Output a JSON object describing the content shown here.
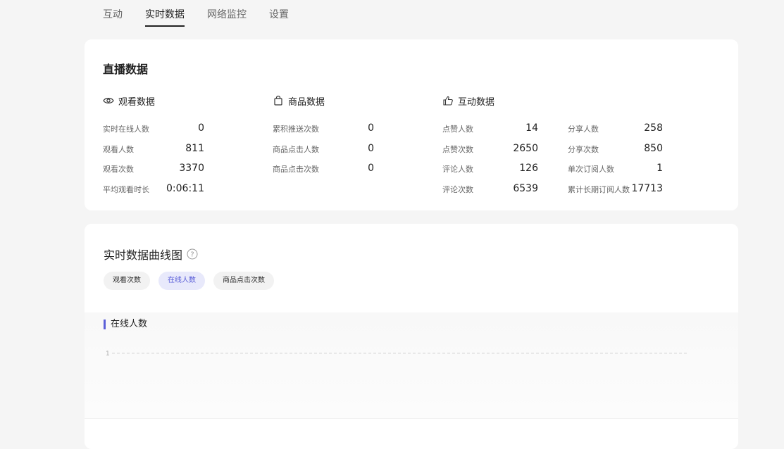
{
  "tabs": [
    {
      "label": "互动"
    },
    {
      "label": "实时数据",
      "active": true
    },
    {
      "label": "网络监控"
    },
    {
      "label": "设置"
    }
  ],
  "live_data": {
    "title": "直播数据",
    "groups": {
      "watch": {
        "label": "观看数据",
        "icon": "eye-icon",
        "metrics": [
          {
            "label": "实时在线人数",
            "value": "0"
          },
          {
            "label": "观看人数",
            "value": "811"
          },
          {
            "label": "观看次数",
            "value": "3370"
          },
          {
            "label": "平均观看时长",
            "value": "0:06:11"
          }
        ]
      },
      "product": {
        "label": "商品数据",
        "icon": "shopping-bag-icon",
        "metrics": [
          {
            "label": "累积推送次数",
            "value": "0"
          },
          {
            "label": "商品点击人数",
            "value": "0"
          },
          {
            "label": "商品点击次数",
            "value": "0"
          }
        ]
      },
      "interaction": {
        "label": "互动数据",
        "icon": "thumbs-up-icon",
        "left_metrics": [
          {
            "label": "点赞人数",
            "value": "14"
          },
          {
            "label": "点赞次数",
            "value": "2650"
          },
          {
            "label": "评论人数",
            "value": "126"
          },
          {
            "label": "评论次数",
            "value": "6539"
          }
        ],
        "right_metrics": [
          {
            "label": "分享人数",
            "value": "258"
          },
          {
            "label": "分享次数",
            "value": "850"
          },
          {
            "label": "单次订阅人数",
            "value": "1"
          },
          {
            "label": "累计长期订阅人数",
            "value": "17713"
          }
        ]
      }
    }
  },
  "realtime_chart": {
    "title": "实时数据曲线图",
    "help_icon": "question-circle-icon",
    "pills": [
      {
        "label": "观看次数"
      },
      {
        "label": "在线人数",
        "active": true
      },
      {
        "label": "商品点击次数"
      }
    ],
    "chart_label": "在线人数",
    "y_tick": "1",
    "accent": "#5b5fd8"
  },
  "chart_data": {
    "type": "line",
    "series": [
      {
        "name": "在线人数",
        "values": []
      }
    ],
    "ylim": [
      0,
      1
    ],
    "y_ticks": [
      1
    ],
    "grid": true
  }
}
